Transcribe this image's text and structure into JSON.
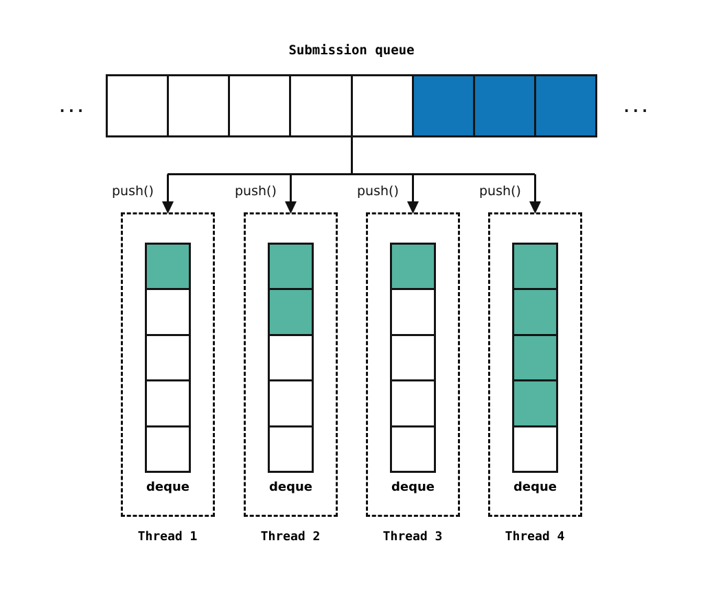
{
  "diagram": {
    "title": "Submission queue",
    "ellipsis_left": "...",
    "ellipsis_right": "...",
    "colors": {
      "queue_filled": "#1177b8",
      "queue_empty": "#ffffff",
      "deque_filled": "#55b5a0",
      "deque_empty": "#ffffff",
      "stroke": "#151515",
      "background": "#ffffff"
    }
  },
  "submission_queue": {
    "label": "Submission queue",
    "cell_count": 8,
    "cells": [
      {
        "index": 0,
        "state": "empty"
      },
      {
        "index": 1,
        "state": "empty"
      },
      {
        "index": 2,
        "state": "empty"
      },
      {
        "index": 3,
        "state": "empty"
      },
      {
        "index": 4,
        "state": "empty"
      },
      {
        "index": 5,
        "state": "filled"
      },
      {
        "index": 6,
        "state": "filled"
      },
      {
        "index": 7,
        "state": "filled"
      }
    ],
    "filled_count": 3,
    "empty_count": 5
  },
  "operations": {
    "push_label": "push()",
    "pushes": [
      "push()",
      "push()",
      "push()",
      "push()"
    ]
  },
  "threads": [
    {
      "id": 1,
      "label": "Thread 1",
      "deque_label": "deque",
      "slot_count": 5,
      "filled_count": 1,
      "slots": [
        "filled",
        "empty",
        "empty",
        "empty",
        "empty"
      ],
      "push_label": "push()"
    },
    {
      "id": 2,
      "label": "Thread 2",
      "deque_label": "deque",
      "slot_count": 5,
      "filled_count": 2,
      "slots": [
        "filled",
        "filled",
        "empty",
        "empty",
        "empty"
      ],
      "push_label": "push()"
    },
    {
      "id": 3,
      "label": "Thread 3",
      "deque_label": "deque",
      "slot_count": 5,
      "filled_count": 1,
      "slots": [
        "filled",
        "empty",
        "empty",
        "empty",
        "empty"
      ],
      "push_label": "push()"
    },
    {
      "id": 4,
      "label": "Thread 4",
      "deque_label": "deque",
      "slot_count": 5,
      "filled_count": 4,
      "slots": [
        "filled",
        "filled",
        "filled",
        "filled",
        "empty"
      ],
      "push_label": "push()"
    }
  ]
}
